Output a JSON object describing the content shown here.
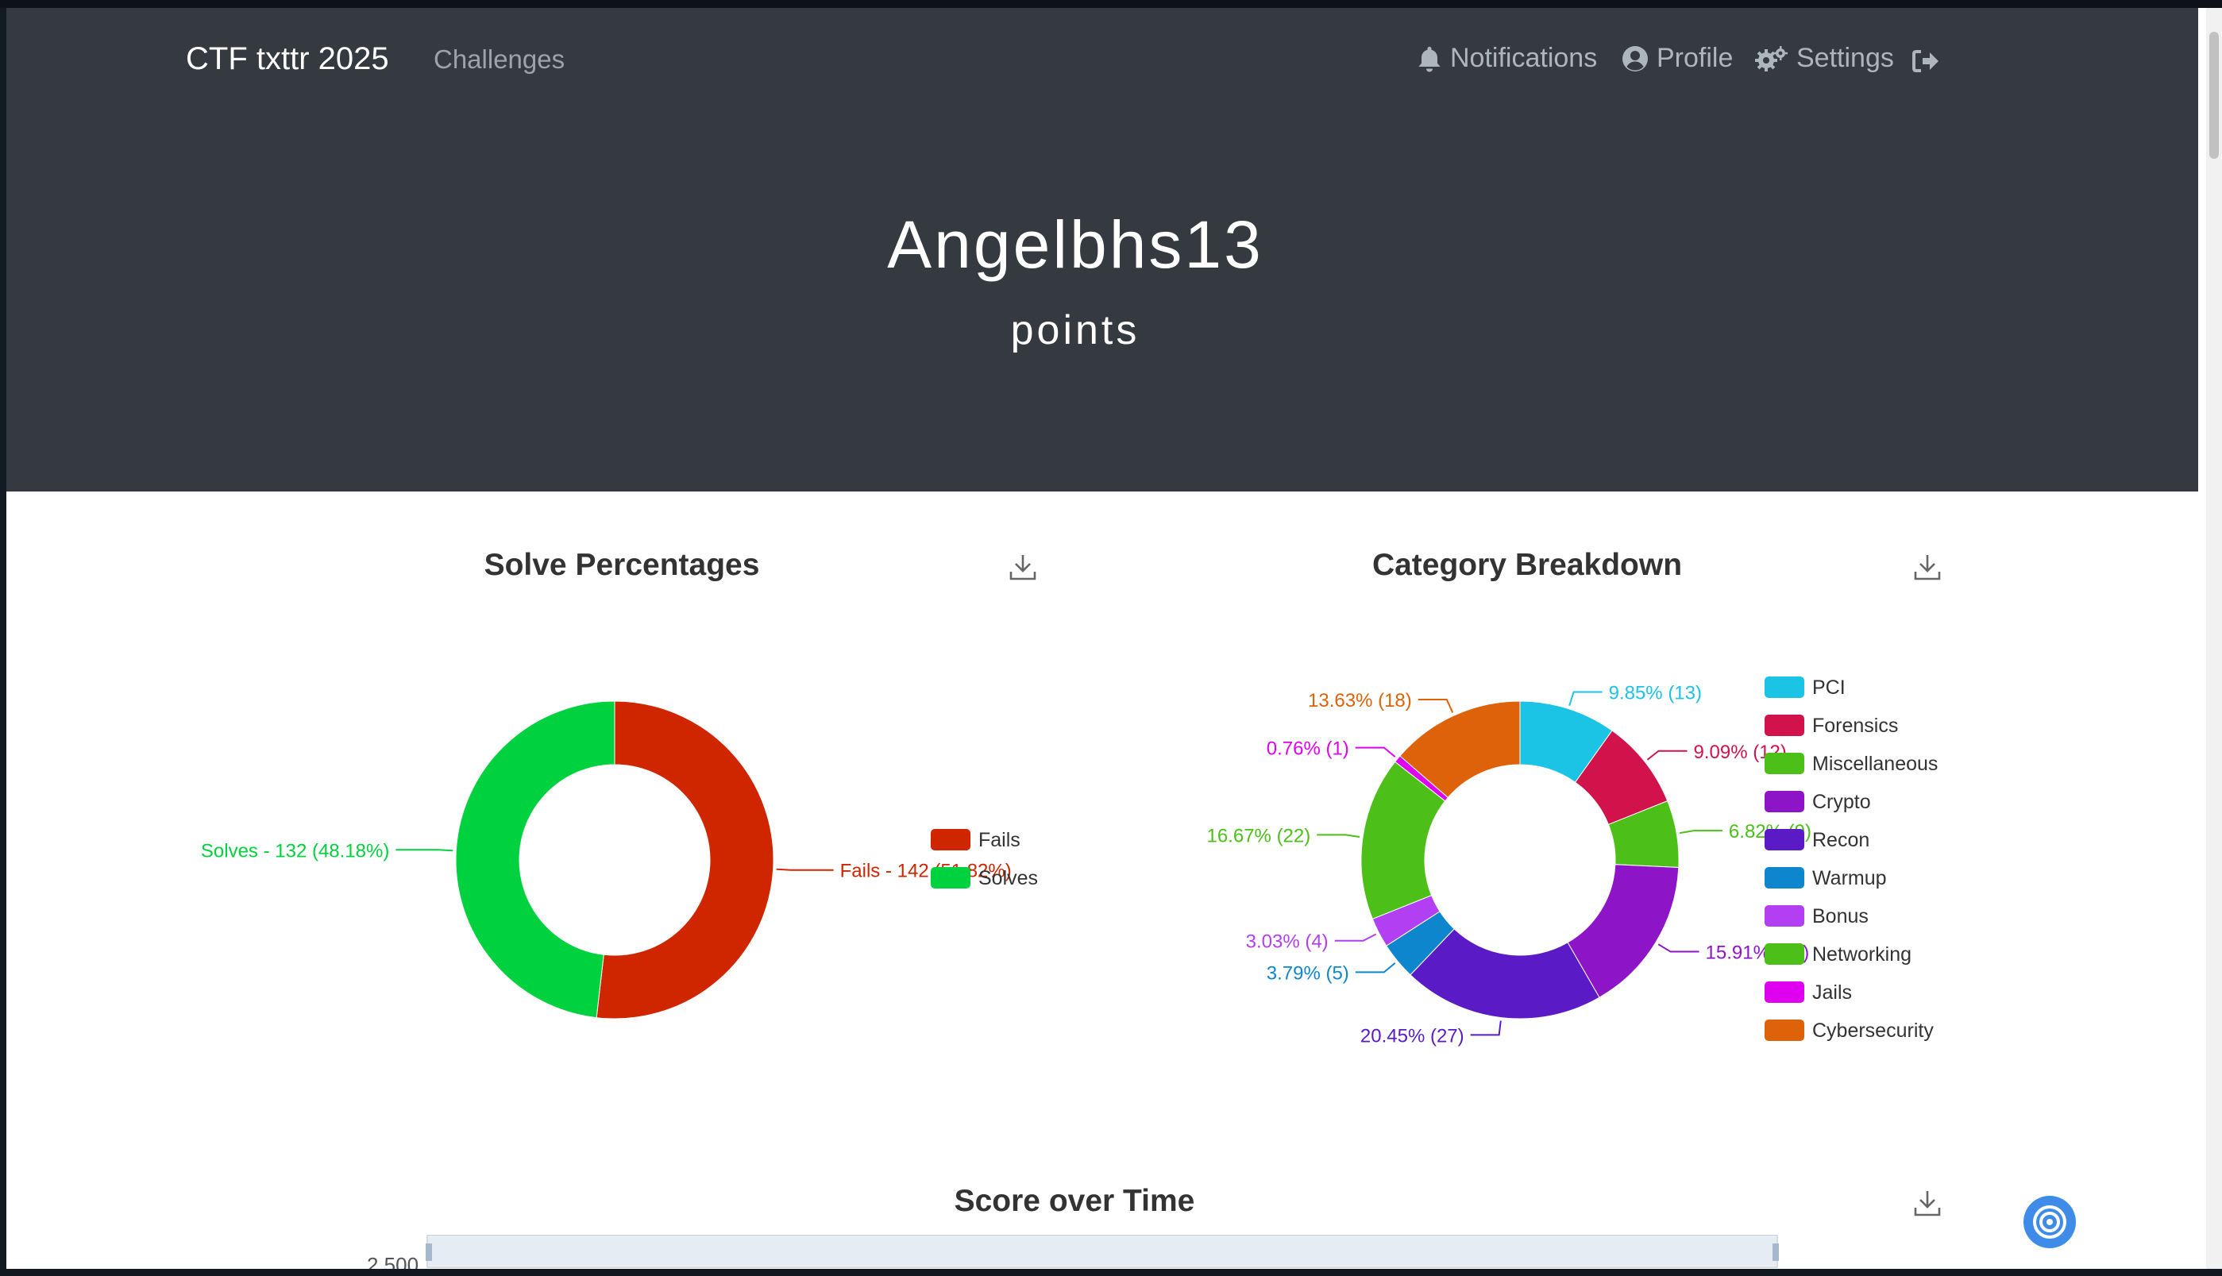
{
  "navbar": {
    "brand": "CTF txttr 2025",
    "links": [
      {
        "label": "Challenges"
      }
    ],
    "right": [
      {
        "label": "Notifications",
        "icon": "bell-icon"
      },
      {
        "label": "Profile",
        "icon": "user-circle-icon"
      },
      {
        "label": "Settings",
        "icon": "gears-icon"
      },
      {
        "label": "",
        "icon": "sign-out-icon"
      }
    ]
  },
  "hero": {
    "username": "Angelbhs13",
    "subtitle": "points"
  },
  "panels": {
    "solve": {
      "title": "Solve Percentages"
    },
    "category": {
      "title": "Category Breakdown"
    },
    "score": {
      "title": "Score over Time"
    }
  },
  "colors": {
    "navbar": "#343a40",
    "accent": "#3f8ce8"
  },
  "chart_data": [
    {
      "type": "pie",
      "title": "Solve Percentages",
      "categories": [
        "Fails",
        "Solves"
      ],
      "values": [
        142,
        132
      ],
      "percentages": [
        "51.82%",
        "48.18%"
      ],
      "colors": [
        "#cf2600",
        "#00d13f"
      ],
      "labels": [
        "Fails - 142 (51.82%)",
        "Solves - 132 (48.18%)"
      ],
      "legend": "right"
    },
    {
      "type": "pie",
      "title": "Category Breakdown",
      "categories": [
        "PCI",
        "Forensics",
        "Miscellaneous",
        "Crypto",
        "Recon",
        "Warmup",
        "Bonus",
        "Networking",
        "Jails",
        "Cybersecurity"
      ],
      "values": [
        13,
        12,
        9,
        21,
        27,
        5,
        4,
        22,
        1,
        18
      ],
      "colors": [
        "#1bc3e5",
        "#d2124b",
        "#4cbf18",
        "#8e14c7",
        "#5a1bc7",
        "#0e86ce",
        "#b23ff1",
        "#4cbf18",
        "#df00f0",
        "#dd620a"
      ],
      "labels": [
        "9.85% (13)",
        "9.09% (12)",
        "6.82% (9)",
        "15.91% (21)",
        "20.45% (27)",
        "3.79% (5)",
        "3.03% (4)",
        "16.67% (22)",
        "0.76% (1)",
        "13.63% (18)"
      ],
      "legend": "right"
    },
    {
      "type": "line",
      "title": "Score over Time",
      "y_tick_visible": "2,500"
    }
  ]
}
